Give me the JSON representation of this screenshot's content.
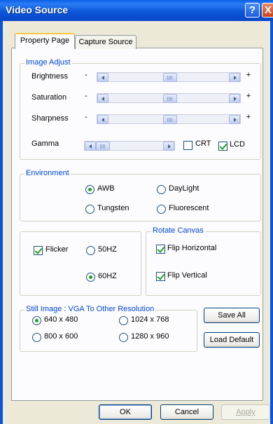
{
  "window": {
    "title": "Video Source",
    "help_glyph": "?",
    "close_glyph": "X"
  },
  "tabs": [
    {
      "label": "Property Page",
      "active": true
    },
    {
      "label": "Capture Source",
      "active": false
    }
  ],
  "image_adjust": {
    "legend": "Image Adjust",
    "minus": "-",
    "plus": "+",
    "sliders": [
      {
        "label": "Brightness",
        "level": 0.5
      },
      {
        "label": "Saturation",
        "level": 0.5
      },
      {
        "label": "Sharpness",
        "level": 0.5
      }
    ],
    "gamma": {
      "label": "Gamma",
      "level": 0.0
    },
    "crt": {
      "label": "CRT",
      "checked": false
    },
    "lcd": {
      "label": "LCD",
      "checked": true
    }
  },
  "environment": {
    "legend": "Environment",
    "options": [
      {
        "label": "AWB",
        "selected": true
      },
      {
        "label": "DayLight",
        "selected": false
      },
      {
        "label": "Tungsten",
        "selected": false
      },
      {
        "label": "Fluorescent",
        "selected": false
      }
    ]
  },
  "flicker": {
    "label": "Flicker",
    "checked": true,
    "hz50": {
      "label": "50HZ",
      "selected": false
    },
    "hz60": {
      "label": "60HZ",
      "selected": true
    }
  },
  "rotate_canvas": {
    "legend": "Rotate Canvas",
    "flip_horizontal": {
      "label": "Flip Horizontal",
      "checked": true
    },
    "flip_vertical": {
      "label": "Flip Vertical",
      "checked": true
    }
  },
  "still_image": {
    "legend": "Still Image : VGA To Other Resolution",
    "options": [
      {
        "label": "640 x 480",
        "selected": true
      },
      {
        "label": "1024 x 768",
        "selected": false
      },
      {
        "label": "800 x 600",
        "selected": false
      },
      {
        "label": "1280 x 960",
        "selected": false
      }
    ]
  },
  "buttons": {
    "save_all": "Save All",
    "load_default": "Load Default",
    "ok": "OK",
    "cancel": "Cancel",
    "apply": "Apply"
  }
}
